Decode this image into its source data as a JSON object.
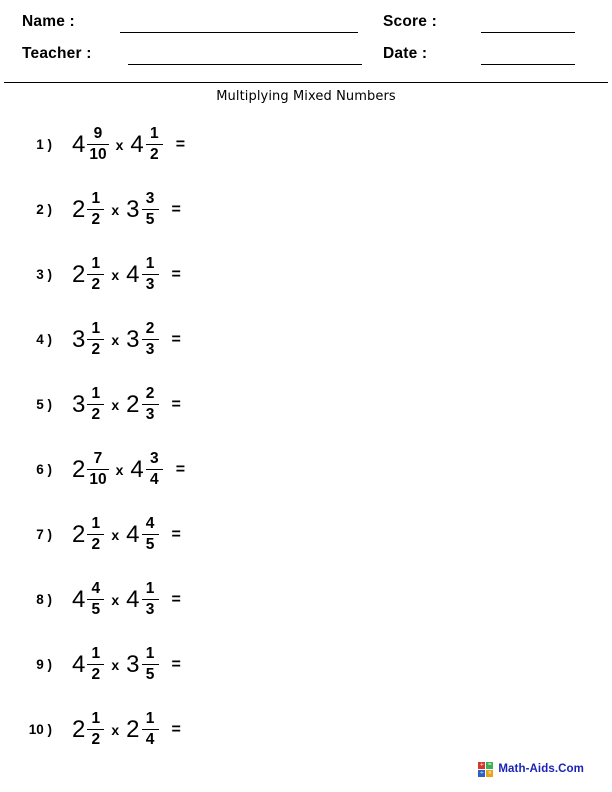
{
  "header": {
    "name_label": "Name :",
    "teacher_label": "Teacher :",
    "score_label": "Score :",
    "date_label": "Date :",
    "name_value": "",
    "teacher_value": "",
    "score_value": "",
    "date_value": ""
  },
  "title": "Multiplying Mixed Numbers",
  "problems": [
    {
      "index": "1 )",
      "a": {
        "whole": "4",
        "num": "9",
        "den": "10"
      },
      "op": "x",
      "b": {
        "whole": "4",
        "num": "1",
        "den": "2"
      },
      "equals": "="
    },
    {
      "index": "2 )",
      "a": {
        "whole": "2",
        "num": "1",
        "den": "2"
      },
      "op": "x",
      "b": {
        "whole": "3",
        "num": "3",
        "den": "5"
      },
      "equals": "="
    },
    {
      "index": "3 )",
      "a": {
        "whole": "2",
        "num": "1",
        "den": "2"
      },
      "op": "x",
      "b": {
        "whole": "4",
        "num": "1",
        "den": "3"
      },
      "equals": "="
    },
    {
      "index": "4 )",
      "a": {
        "whole": "3",
        "num": "1",
        "den": "2"
      },
      "op": "x",
      "b": {
        "whole": "3",
        "num": "2",
        "den": "3"
      },
      "equals": "="
    },
    {
      "index": "5 )",
      "a": {
        "whole": "3",
        "num": "1",
        "den": "2"
      },
      "op": "x",
      "b": {
        "whole": "2",
        "num": "2",
        "den": "3"
      },
      "equals": "="
    },
    {
      "index": "6 )",
      "a": {
        "whole": "2",
        "num": "7",
        "den": "10"
      },
      "op": "x",
      "b": {
        "whole": "4",
        "num": "3",
        "den": "4"
      },
      "equals": "="
    },
    {
      "index": "7 )",
      "a": {
        "whole": "2",
        "num": "1",
        "den": "2"
      },
      "op": "x",
      "b": {
        "whole": "4",
        "num": "4",
        "den": "5"
      },
      "equals": "="
    },
    {
      "index": "8 )",
      "a": {
        "whole": "4",
        "num": "4",
        "den": "5"
      },
      "op": "x",
      "b": {
        "whole": "4",
        "num": "1",
        "den": "3"
      },
      "equals": "="
    },
    {
      "index": "9 )",
      "a": {
        "whole": "4",
        "num": "1",
        "den": "2"
      },
      "op": "x",
      "b": {
        "whole": "3",
        "num": "1",
        "den": "5"
      },
      "equals": "="
    },
    {
      "index": "10 )",
      "a": {
        "whole": "2",
        "num": "1",
        "den": "2"
      },
      "op": "x",
      "b": {
        "whole": "2",
        "num": "1",
        "den": "4"
      },
      "equals": "="
    }
  ],
  "footer": {
    "brand": "Math-Aids.Com",
    "brand_color": "#1a23b8",
    "icon_name": "math-aids-logo-icon",
    "icon_tiles": [
      {
        "glyph": "+",
        "color": "#d23b2c"
      },
      {
        "glyph": "=",
        "color": "#3fae54"
      },
      {
        "glyph": "÷",
        "color": "#2f5fbf"
      },
      {
        "glyph": "×",
        "color": "#e8a21c"
      }
    ]
  }
}
